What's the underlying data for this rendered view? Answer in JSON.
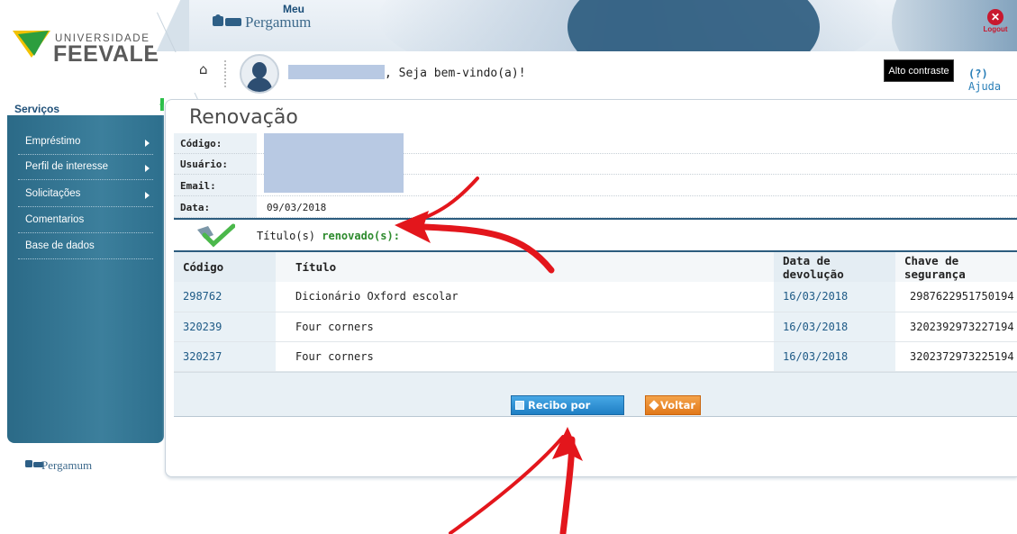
{
  "header": {
    "logo_top": "UNIVERSIDADE",
    "logo_main": "FEEVALE",
    "brand_small": "Meu",
    "brand_name": "Pergamum",
    "logout_label": "Logout",
    "welcome_text": ", Seja bem-vindo(a)!",
    "contrast_button": "Alto contraste",
    "help_prefix": "(?)",
    "help_label": "Ajuda"
  },
  "sidebar": {
    "title": "Serviços",
    "items": [
      {
        "label": "Empréstimo",
        "has_arrow": true
      },
      {
        "label": "Perfil de interesse",
        "has_arrow": true
      },
      {
        "label": "Solicitações",
        "has_arrow": true
      },
      {
        "label": "Comentarios",
        "has_arrow": false
      },
      {
        "label": "Base de dados",
        "has_arrow": false
      }
    ],
    "footer_brand": "Pergamum"
  },
  "page": {
    "title": "Renovação",
    "info": {
      "codigo_label": "Código:",
      "usuario_label": "Usuário:",
      "email_label": "Email:",
      "data_label": "Data:",
      "data_value": "09/03/2018"
    },
    "renew_message_prefix": "Título(s) ",
    "renew_message_bold": "renovado(s):"
  },
  "table": {
    "headers": [
      "Código",
      "Título",
      "Data de devolução",
      "Chave de segurança"
    ],
    "rows": [
      [
        "298762",
        "Dicionário Oxford escolar",
        "16/03/2018",
        "2987622951750194"
      ],
      [
        "320239",
        "Four corners",
        "16/03/2018",
        "3202392973227194"
      ],
      [
        "320237",
        "Four corners",
        "16/03/2018",
        "3202372973225194"
      ]
    ]
  },
  "buttons": {
    "email_receipt": "Recibo por email",
    "back": "Voltar"
  },
  "colors": {
    "sidebar": "#2d6e8c",
    "accent_blue": "#1e7fc4",
    "accent_orange": "#e1781a",
    "annotation_arrow": "#e3161c"
  }
}
